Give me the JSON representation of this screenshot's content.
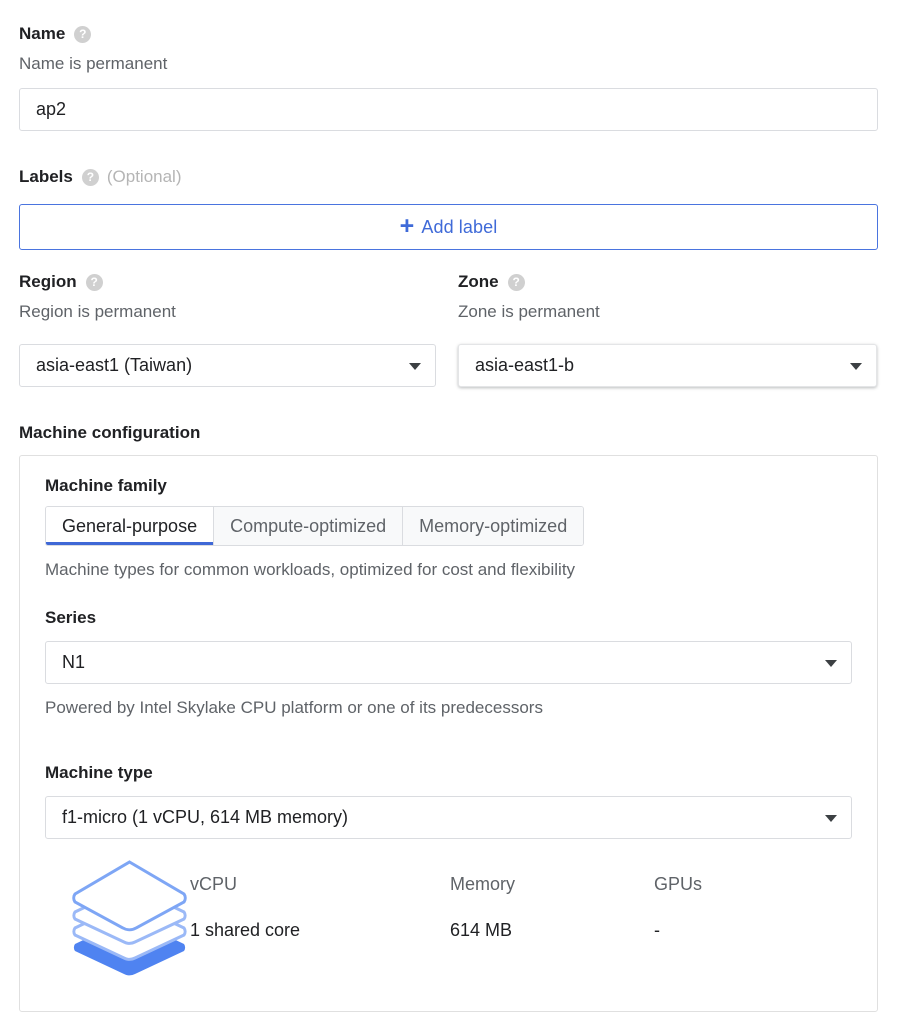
{
  "name_field": {
    "label": "Name",
    "help_icon": "help-icon",
    "hint": "Name is permanent",
    "value": "ap2",
    "placeholder": ""
  },
  "labels_field": {
    "label": "Labels",
    "help_icon": "help-icon",
    "optional": "(Optional)",
    "add_button": "Add label",
    "add_icon": "plus-icon",
    "accent_color": "#3f6ad8"
  },
  "region_field": {
    "label": "Region",
    "help_icon": "help-icon",
    "hint": "Region is permanent",
    "value": "asia-east1 (Taiwan)",
    "caret_icon": "chevron-down-icon"
  },
  "zone_field": {
    "label": "Zone",
    "help_icon": "help-icon",
    "hint": "Zone is permanent",
    "value": "asia-east1-b",
    "caret_icon": "chevron-down-icon"
  },
  "machine_configuration": {
    "title": "Machine configuration",
    "machine_family": {
      "title": "Machine family",
      "tabs": [
        {
          "label": "General-purpose",
          "selected": true
        },
        {
          "label": "Compute-optimized",
          "selected": false
        },
        {
          "label": "Memory-optimized",
          "selected": false
        }
      ],
      "description": "Machine types for common workloads, optimized for cost and flexibility",
      "selected_underline_color": "#3f68d6"
    },
    "series": {
      "title": "Series",
      "value": "N1",
      "description": "Powered by Intel Skylake CPU platform or one of its predecessors",
      "caret_icon": "chevron-down-icon"
    },
    "machine_type": {
      "title": "Machine type",
      "value": "f1-micro (1 vCPU, 614 MB memory)",
      "caret_icon": "chevron-down-icon"
    },
    "spec_summary": {
      "icon": "layers-stack-icon",
      "icon_color": "#4f83f1",
      "columns": [
        {
          "header": "vCPU",
          "value": "1 shared core"
        },
        {
          "header": "Memory",
          "value": "614 MB"
        },
        {
          "header": "GPUs",
          "value": "-"
        }
      ]
    }
  }
}
